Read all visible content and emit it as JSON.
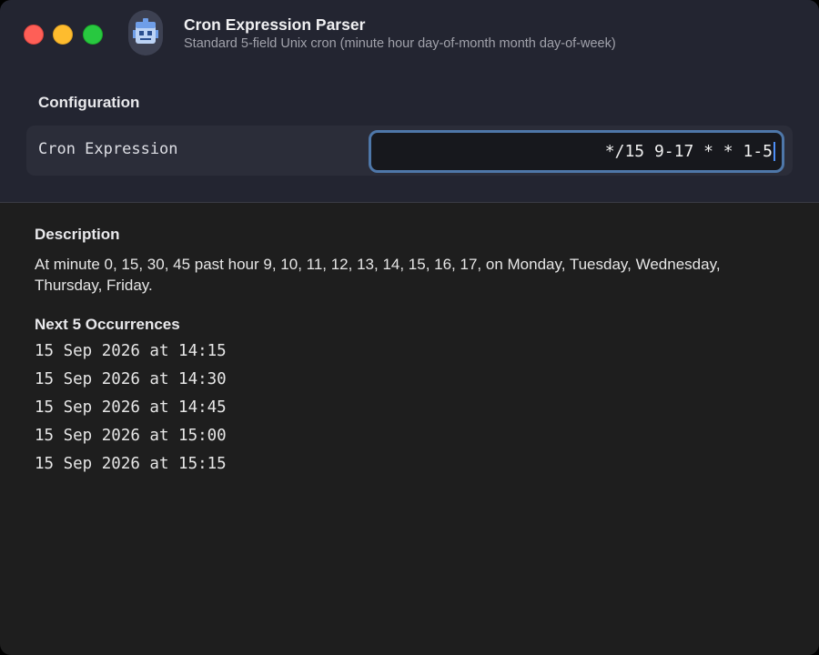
{
  "app": {
    "title": "Cron Expression Parser",
    "subtitle": "Standard 5-field Unix cron (minute hour day-of-month month day-of-week)",
    "icon": "app-icon"
  },
  "window_controls": {
    "close_color": "#fe5f57",
    "minimize_color": "#febc2e",
    "maximize_color": "#28c840"
  },
  "configuration": {
    "title": "Configuration",
    "field_label": "Cron Expression",
    "cron_value": "*/15 9-17 * * 1-5"
  },
  "description": {
    "title": "Description",
    "text": "At minute 0, 15, 30, 45 past hour 9, 10, 11, 12, 13, 14, 15, 16, 17, on Monday, Tuesday, Wednesday, Thursday, Friday."
  },
  "occurrences": {
    "title": "Next 5 Occurrences",
    "items": [
      "15 Sep 2026 at 14:15",
      "15 Sep 2026 at 14:30",
      "15 Sep 2026 at 14:45",
      "15 Sep 2026 at 15:00",
      "15 Sep 2026 at 15:15"
    ]
  },
  "colors": {
    "accent": "#4e77a9",
    "caret": "#4d8ef7",
    "header_bg": "#232531",
    "content_bg": "#1e1e1e"
  }
}
